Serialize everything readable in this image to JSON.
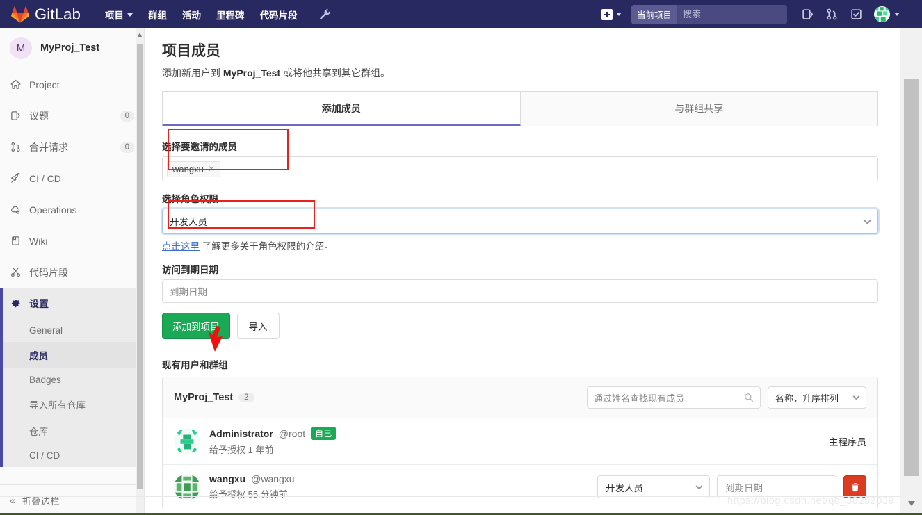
{
  "topnav": {
    "brand": "GitLab",
    "links": [
      {
        "label": "项目",
        "has_caret": true,
        "name": "nav-projects"
      },
      {
        "label": "群组",
        "has_caret": false,
        "name": "nav-groups"
      },
      {
        "label": "活动",
        "has_caret": false,
        "name": "nav-activity"
      },
      {
        "label": "里程碑",
        "has_caret": false,
        "name": "nav-milestones"
      },
      {
        "label": "代码片段",
        "has_caret": false,
        "name": "nav-snippets"
      }
    ],
    "wrench_icon": "wrench-icon",
    "plus_icon": "plus-square-icon",
    "search": {
      "scope_label": "当前项目",
      "placeholder": "搜索",
      "value": "",
      "icon": "search-icon"
    },
    "icons": [
      {
        "name": "issues-icon",
        "label": "议题"
      },
      {
        "name": "merge-requests-icon",
        "label": "合并请求"
      },
      {
        "name": "todos-icon",
        "label": "待办事项"
      }
    ],
    "avatar": {
      "name": "user-avatar",
      "caret": true
    }
  },
  "sidebar": {
    "project": {
      "initial": "M",
      "name": "MyProj_Test"
    },
    "items": [
      {
        "label": "Project",
        "icon": "home-icon",
        "badge": ""
      },
      {
        "label": "议题",
        "icon": "issues-icon",
        "badge": "0"
      },
      {
        "label": "合并请求",
        "icon": "merge-request-icon",
        "badge": "0"
      },
      {
        "label": "CI / CD",
        "icon": "rocket-icon",
        "badge": ""
      },
      {
        "label": "Operations",
        "icon": "cloud-gear-icon",
        "badge": ""
      },
      {
        "label": "Wiki",
        "icon": "book-icon",
        "badge": ""
      },
      {
        "label": "代码片段",
        "icon": "scissors-icon",
        "badge": ""
      }
    ],
    "settings": {
      "label": "设置",
      "icon": "gear-icon"
    },
    "sub_items": [
      {
        "label": "General",
        "current": false
      },
      {
        "label": "成员",
        "current": true
      },
      {
        "label": "Badges",
        "current": false
      },
      {
        "label": "导入所有仓库",
        "current": false
      },
      {
        "label": "仓库",
        "current": false
      },
      {
        "label": "CI / CD",
        "current": false
      }
    ],
    "collapse_label": "折叠边栏",
    "collapse_icon": "double-chevron-left-icon"
  },
  "page": {
    "title": "项目成员",
    "subtitle_pre": "添加新用户到 ",
    "subtitle_project": "MyProj_Test",
    "subtitle_post": " 或将他共享到其它群组。",
    "tabs": [
      {
        "label": "添加成员",
        "active": true
      },
      {
        "label": "与群组共享",
        "active": false
      }
    ]
  },
  "add_form": {
    "invite_label": "选择要邀请的成员",
    "invite_tokens": [
      {
        "text": "wangxu",
        "remove_icon": "close-x-icon"
      }
    ],
    "role_label": "选择角色权限",
    "role_value": "开发人员",
    "help_link": "点击这里",
    "help_text": " 了解更多关于角色权限的介绍。",
    "expire_label": "访问到期日期",
    "expire_placeholder": "到期日期",
    "expire_value": "",
    "submit_label": "添加到项目",
    "import_label": "导入"
  },
  "existing": {
    "section_title": "现有用户和群组",
    "group_name": "MyProj_Test",
    "group_count": "2",
    "search_placeholder": "通过姓名查找现有成员",
    "search_value": "",
    "search_icon": "search-icon",
    "sort_value": "名称，升序排列",
    "members": [
      {
        "name": "Administrator",
        "handle": "@root",
        "badge": "自己",
        "meta": "给予授权 1 年前",
        "role_static": "主程序员",
        "has_controls": false
      },
      {
        "name": "wangxu",
        "handle": "@wangxu",
        "badge": "",
        "meta": "给予授权 55 分钟前",
        "role_select": "开发人员",
        "expire_placeholder": "到期日期",
        "delete_icon": "trash-icon",
        "has_controls": true
      }
    ]
  },
  "watermark": "https://blog.csdn.net/qq_38252039",
  "colors": {
    "nav_bg": "#292961",
    "accent": "#6b6bc4",
    "green": "#1aaa55",
    "red": "#db3b21",
    "annotation": "#e8221a"
  }
}
